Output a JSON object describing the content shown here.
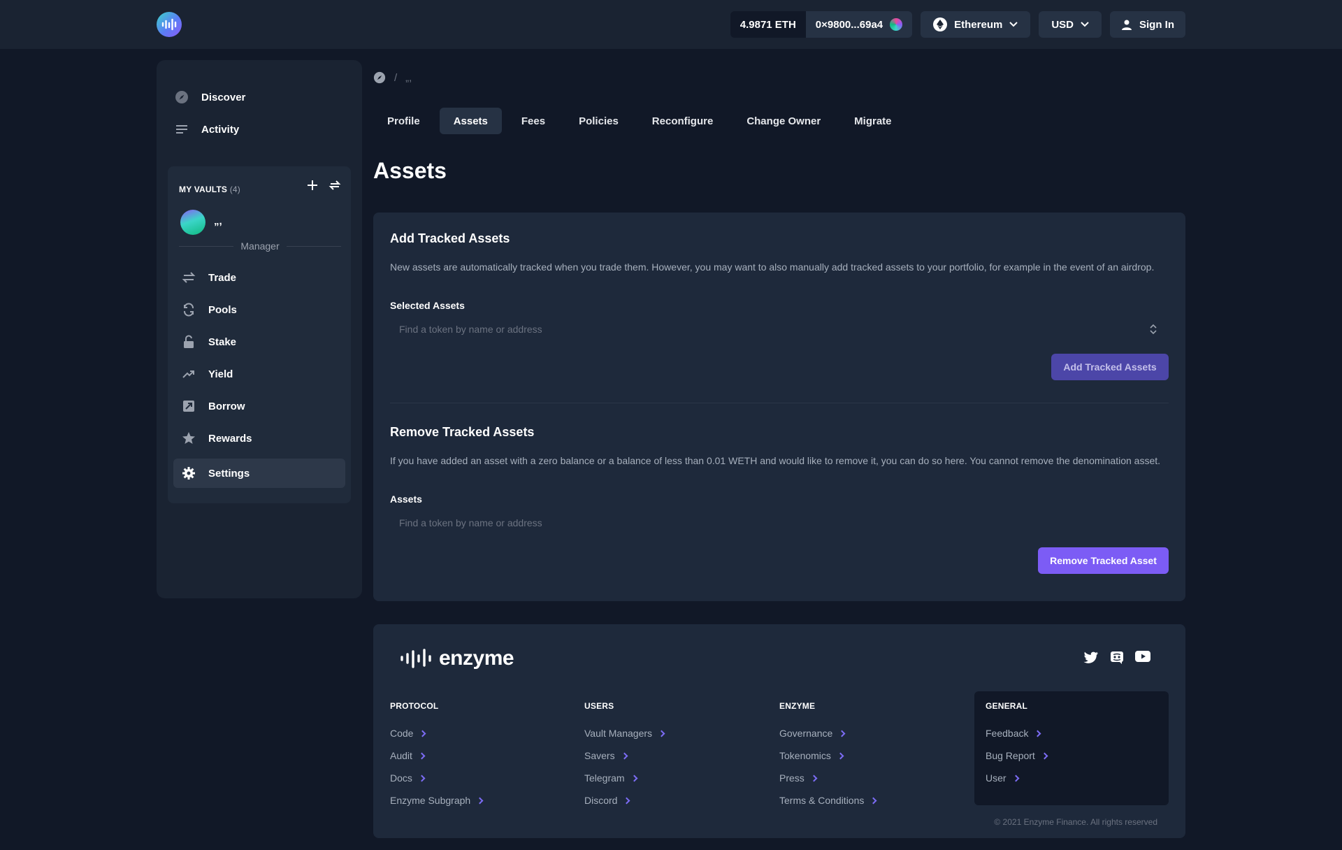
{
  "header": {
    "balance": "4.9871 ETH",
    "wallet_address": "0×9800...69a4",
    "network": "Ethereum",
    "currency": "USD",
    "sign_in": "Sign In"
  },
  "sidebar": {
    "discover": "Discover",
    "activity": "Activity",
    "vaults_title": "MY VAULTS",
    "vaults_count": "(4)",
    "vault_name": "„,",
    "manager_label": "Manager",
    "items": [
      {
        "label": "Trade",
        "icon": "swap-icon"
      },
      {
        "label": "Pools",
        "icon": "pools-icon"
      },
      {
        "label": "Stake",
        "icon": "lock-icon"
      },
      {
        "label": "Yield",
        "icon": "trending-up-icon"
      },
      {
        "label": "Borrow",
        "icon": "borrow-icon"
      },
      {
        "label": "Rewards",
        "icon": "star-icon"
      },
      {
        "label": "Settings",
        "icon": "gear-icon"
      }
    ]
  },
  "breadcrumb": {
    "separator": "/",
    "current": "„,"
  },
  "tabs": [
    "Profile",
    "Assets",
    "Fees",
    "Policies",
    "Reconfigure",
    "Change Owner",
    "Migrate"
  ],
  "page_title": "Assets",
  "add_section": {
    "title": "Add Tracked Assets",
    "description": "New assets are automatically tracked when you trade them. However, you may want to also manually add tracked assets to your portfolio, for example in the event of an airdrop.",
    "field_label": "Selected Assets",
    "placeholder": "Find a token by name or address",
    "button": "Add Tracked Assets"
  },
  "remove_section": {
    "title": "Remove Tracked Assets",
    "description": "If you have added an asset with a zero balance or a balance of less than 0.01 WETH and would like to remove it, you can do so here. You cannot remove the denomination asset.",
    "field_label": "Assets",
    "placeholder": "Find a token by name or address",
    "button": "Remove Tracked Asset"
  },
  "footer": {
    "brand": "enzyme",
    "columns": [
      {
        "head": "PROTOCOL",
        "links": [
          "Code",
          "Audit",
          "Docs",
          "Enzyme Subgraph"
        ]
      },
      {
        "head": "USERS",
        "links": [
          "Vault Managers",
          "Savers",
          "Telegram",
          "Discord"
        ]
      },
      {
        "head": "ENZYME",
        "links": [
          "Governance",
          "Tokenomics",
          "Press",
          "Terms & Conditions"
        ]
      },
      {
        "head": "GENERAL",
        "links": [
          "Feedback",
          "Bug Report",
          "User"
        ]
      }
    ],
    "copyright": "© 2021 Enzyme Finance. All rights reserved"
  },
  "colors": {
    "accent": "#7c5cf5",
    "background": "#111827",
    "panel": "#1e293b"
  }
}
